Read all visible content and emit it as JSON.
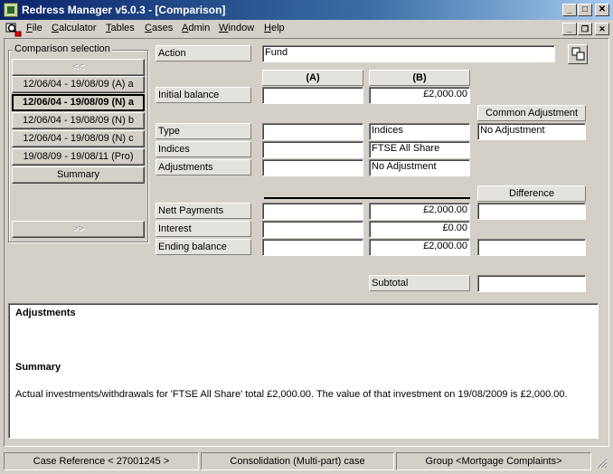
{
  "window": {
    "title": "Redress Manager v5.0.3 - [Comparison]",
    "min_glyph": "_",
    "max_glyph": "□",
    "close_glyph": "✕",
    "mdi_min_glyph": "_",
    "mdi_restore_glyph": "❐",
    "mdi_close_glyph": "✕"
  },
  "menu": [
    {
      "underline": "F",
      "rest": "ile"
    },
    {
      "underline": "C",
      "rest": "alculator"
    },
    {
      "underline": "T",
      "rest": "ables"
    },
    {
      "underline": "C",
      "rest": "ases"
    },
    {
      "underline": "A",
      "rest": "dmin"
    },
    {
      "underline": "W",
      "rest": "indow"
    },
    {
      "underline": "H",
      "rest": "elp"
    }
  ],
  "selection": {
    "legend": "Comparison selection",
    "prev": "<<",
    "next": ">>",
    "items": [
      "12/06/04 - 19/08/09 (A) a",
      "12/06/04 - 19/08/09 (N) a",
      "12/06/04 - 19/08/09 (N) b",
      "12/06/04 - 19/08/09 (N) c",
      "19/08/09 - 19/08/11 (Pro)",
      "Summary"
    ]
  },
  "form": {
    "action_label": "Action",
    "action_value": "Fund",
    "col_a": "(A)",
    "col_b": "(B)",
    "initial_balance_label": "Initial balance",
    "initial_balance_a": "",
    "initial_balance_b": "£2,000.00",
    "common_adjustment_label": "Common Adjustment",
    "common_adjustment_value": "No Adjustment",
    "type_label": "Type",
    "type_a": "",
    "type_b": "Indices",
    "indices_label": "Indices",
    "indices_a": "",
    "indices_b": "FTSE All Share",
    "adjustments_label": "Adjustments",
    "adjustments_a": "",
    "adjustments_b": "No Adjustment",
    "difference_label": "Difference",
    "nett_payments_label": "Nett Payments",
    "nett_payments_a": "",
    "nett_payments_b": "£2,000.00",
    "nett_payments_diff": "",
    "interest_label": "Interest",
    "interest_a": "",
    "interest_b": "£0.00",
    "ending_balance_label": "Ending balance",
    "ending_balance_a": "",
    "ending_balance_b": "£2,000.00",
    "ending_balance_diff": "",
    "subtotal_label": "Subtotal",
    "subtotal_value": ""
  },
  "panel": {
    "adjustments_heading": "Adjustments",
    "summary_heading": "Summary",
    "summary_text": "Actual investments/withdrawals for 'FTSE All Share' total £2,000.00. The value of that investment on 19/08/2009 is £2,000.00."
  },
  "status": {
    "case_reference": "Case Reference < 27001245 >",
    "consolidation": "Consolidation (Multi-part) case",
    "group": "Group <Mortgage Complaints>"
  },
  "colors": {
    "titlebar_start": "#0a246a",
    "face": "#d4d0c8"
  }
}
